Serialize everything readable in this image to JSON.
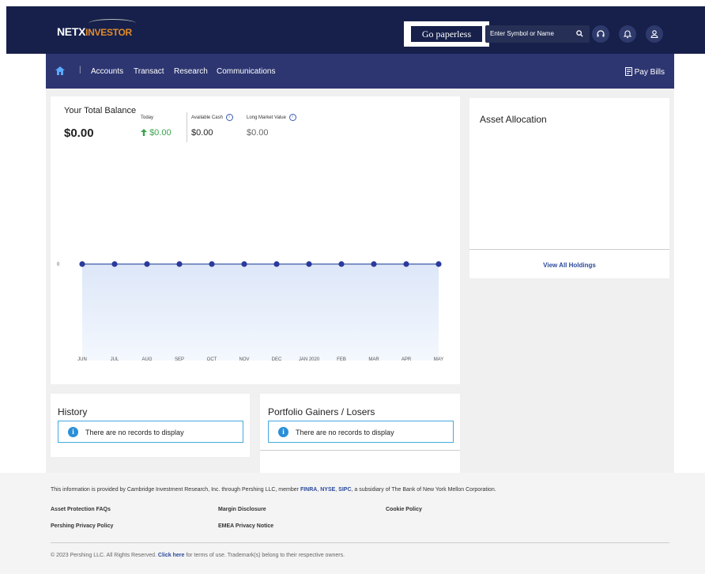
{
  "header": {
    "logo_part1": "NETX",
    "logo_part2": "INVESTOR",
    "paperless_label": "Go paperless",
    "search_placeholder": "Enter Symbol or Name"
  },
  "icons": {
    "search": "search-icon",
    "support": "headset-icon",
    "notifications": "bell-icon",
    "profile": "user-icon",
    "home": "home-icon",
    "paybills": "receipt-icon",
    "info": "info-icon"
  },
  "nav": {
    "separator": "|",
    "items": [
      "Accounts",
      "Transact",
      "Research",
      "Communications"
    ],
    "pay_bills": "Pay Bills"
  },
  "balance": {
    "title": "Your Total Balance",
    "value": "$0.00",
    "today_label": "Today",
    "today_value": "$0.00",
    "cash_label": "Available Cash",
    "cash_value": "$0.00",
    "lmv_label": "Long Market Value",
    "lmv_value": "$0.00"
  },
  "chart_data": {
    "type": "area",
    "categories": [
      "JUN",
      "JUL",
      "AUG",
      "SEP",
      "OCT",
      "NOV",
      "DEC",
      "JAN 2020",
      "FEB",
      "MAR",
      "APR",
      "MAY"
    ],
    "values": [
      0,
      0,
      0,
      0,
      0,
      0,
      0,
      0,
      0,
      0,
      0,
      0
    ],
    "y_tick_labels": [
      "0"
    ],
    "grid": false
  },
  "asset_allocation": {
    "title": "Asset Allocation",
    "link": "View All Holdings"
  },
  "history": {
    "title": "History",
    "message": "There are no records to display"
  },
  "gainers": {
    "title": "Portfolio Gainers / Losers",
    "message": "There are no records to display"
  },
  "footer": {
    "info_prefix": "This information is provided by Cambridge Investment Research, Inc. through Pershing LLC, member ",
    "finra": "FINRA",
    "nyse": "NYSE",
    "sipc": "SIPC",
    "info_suffix": ", a subsidiary of The Bank of New York Mellon Corporation.",
    "links": [
      "Asset Protection FAQs",
      "Margin Disclosure",
      "Cookie Policy",
      "Pershing Privacy Policy",
      "EMEA Privacy Notice"
    ],
    "copyright_prefix": "© 2023 Pershing LLC. All Rights Reserved. ",
    "click_here": "Click here",
    "copyright_suffix": " for terms of use. Trademark(s) belong to their respective owners."
  },
  "colors": {
    "header_bg": "#16204a",
    "nav_bg": "#2d3671",
    "accent": "#2b3a9b",
    "positive": "#3aa44a",
    "info": "#2a8fd8"
  }
}
